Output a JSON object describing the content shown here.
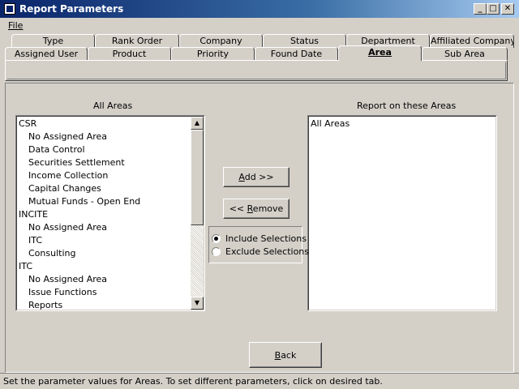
{
  "window": {
    "title": "Report Parameters",
    "minimize": "_",
    "maximize": "□",
    "close": "✕"
  },
  "menu": {
    "file_label": "File"
  },
  "tabs_row1": [
    "Type",
    "Rank Order",
    "Company",
    "Status",
    "Department",
    "Affiliated Company"
  ],
  "tabs_row2": [
    "Assigned User",
    "Product",
    "Priority",
    "Found Date",
    "Area",
    "Sub Area"
  ],
  "active_tab": "Area",
  "left_list": {
    "label": "All Areas",
    "items": [
      {
        "text": "CSR",
        "indent": 0
      },
      {
        "text": "No Assigned Area",
        "indent": 1
      },
      {
        "text": "Data Control",
        "indent": 1
      },
      {
        "text": "Securities Settlement",
        "indent": 1
      },
      {
        "text": "Income Collection",
        "indent": 1
      },
      {
        "text": "Capital Changes",
        "indent": 1
      },
      {
        "text": "Mutual Funds - Open End",
        "indent": 1
      },
      {
        "text": "INCITE",
        "indent": 0
      },
      {
        "text": "No Assigned Area",
        "indent": 1
      },
      {
        "text": "ITC",
        "indent": 1
      },
      {
        "text": "Consulting",
        "indent": 1
      },
      {
        "text": "ITC",
        "indent": 0
      },
      {
        "text": "No Assigned Area",
        "indent": 1
      },
      {
        "text": "Issue Functions",
        "indent": 1
      },
      {
        "text": "Reports",
        "indent": 1
      }
    ]
  },
  "right_list": {
    "label": "Report on these Areas",
    "items": [
      "All Areas"
    ]
  },
  "buttons": {
    "add_prefix": "",
    "add_ul": "A",
    "add_suffix": "dd >>",
    "remove_prefix": "<< ",
    "remove_ul": "R",
    "remove_suffix": "emove",
    "back_ul": "B",
    "back_suffix": "ack"
  },
  "options": {
    "include_label": "Include Selections",
    "exclude_label": "Exclude Selections",
    "selected": "include"
  },
  "status_text": "Set the parameter values for Areas.  To set different parameters, click on desired tab."
}
